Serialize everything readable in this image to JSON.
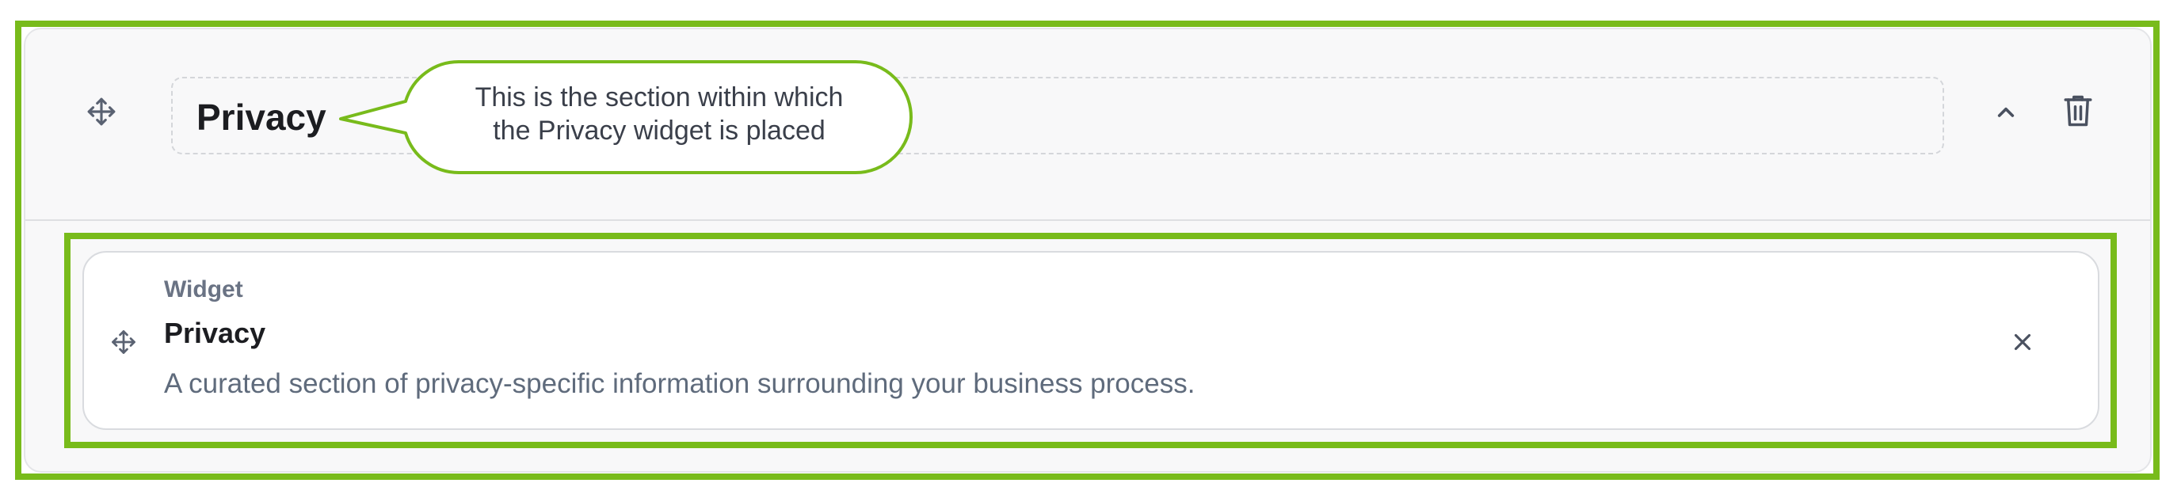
{
  "section": {
    "title": "Privacy",
    "icons": {
      "move": "move-arrows-icon",
      "collapse": "chevron-up-icon",
      "delete": "trash-icon"
    }
  },
  "widget": {
    "kind_label": "Widget",
    "title": "Privacy",
    "description": "A curated section of privacy-specific information surrounding your business process.",
    "icons": {
      "move": "move-arrows-icon",
      "remove": "close-icon"
    }
  },
  "callout": {
    "line1": "This is the section within which",
    "line2": "the Privacy widget is placed"
  },
  "colors": {
    "highlight": "#78bb1b",
    "card_bg": "#f8f8f9",
    "title_text": "#1c1d21",
    "muted_text": "#6a7384"
  }
}
